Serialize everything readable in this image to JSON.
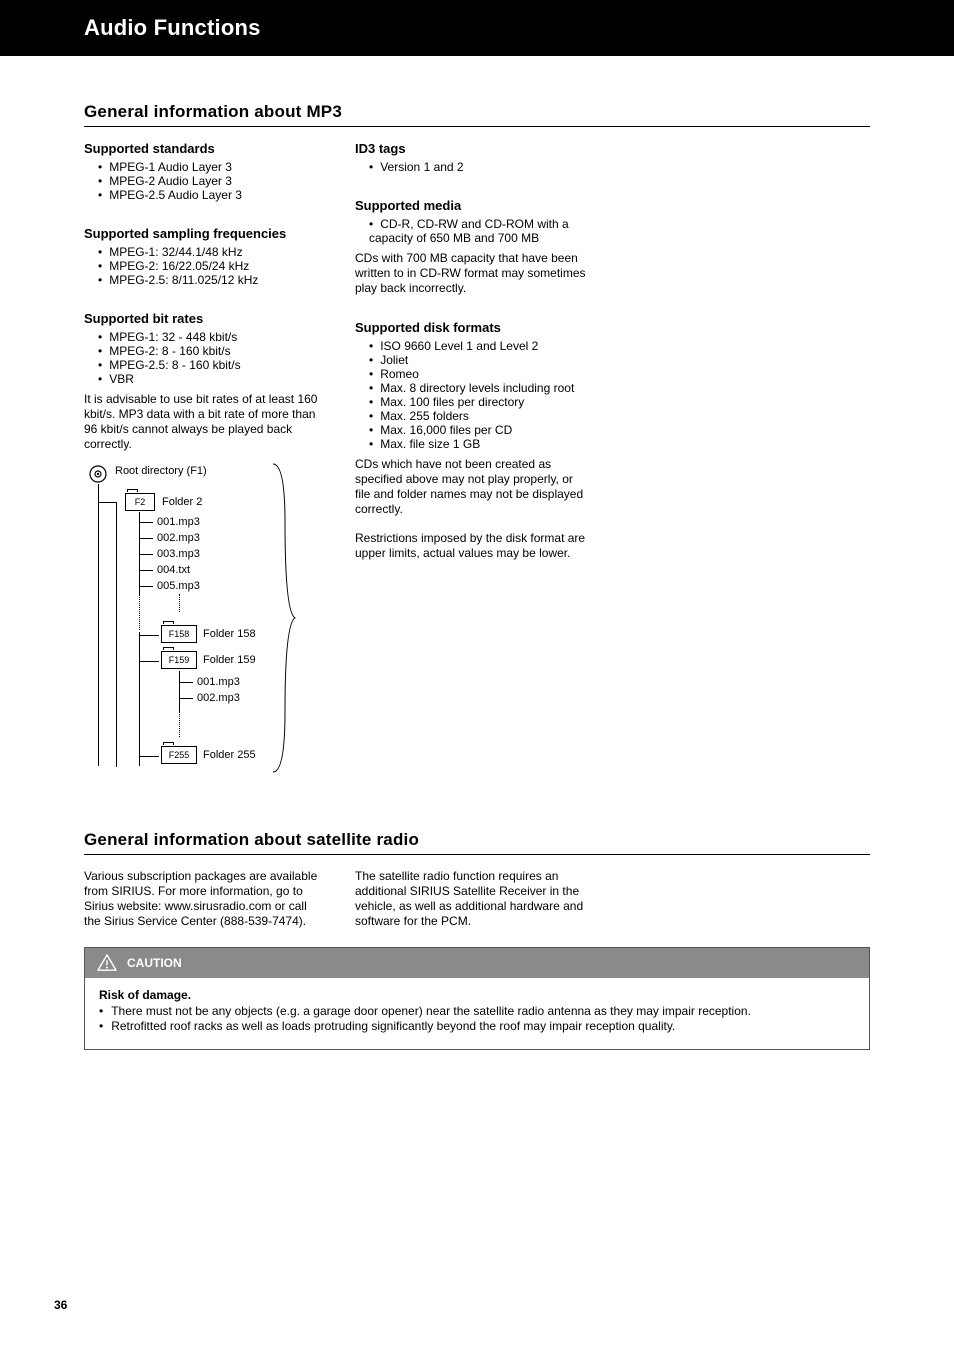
{
  "header": {
    "title": "Audio Functions"
  },
  "section1": {
    "heading": "General information about MP3",
    "supported": {
      "title": "Supported standards",
      "items": [
        "MPEG-1 Audio Layer 3",
        "MPEG-2 Audio Layer 3",
        "MPEG-2.5 Audio Layer 3"
      ]
    },
    "sampling": {
      "title": "Supported sampling frequencies",
      "items": [
        "MPEG-1: 32/44.1/48 kHz",
        "MPEG-2: 16/22.05/24 kHz",
        "MPEG-2.5: 8/11.025/12 kHz"
      ]
    },
    "bitrates": {
      "title": "Supported bit rates",
      "items": [
        "MPEG-1: 32 - 448 kbit/s",
        "MPEG-2: 8 - 160 kbit/s",
        "MPEG-2.5: 8 - 160 kbit/s",
        "VBR"
      ],
      "note": "It is advisable to use bit rates of at least 160 kbit/s. MP3 data with a bit rate of more than 96 kbit/s cannot always be played back correctly."
    },
    "id3": {
      "title": "ID3 tags",
      "items": [
        "Version 1 and 2"
      ]
    },
    "media": {
      "title": "Supported media",
      "items": [
        "CD-R, CD-RW and CD-ROM with a capacity of 650 MB and 700 MB"
      ],
      "note": "CDs with 700 MB capacity that have been written to in CD-RW format may sometimes play back incorrectly."
    },
    "formats": {
      "title": "Supported disk formats",
      "items": [
        "ISO 9660 Level 1 and Level 2",
        "Joliet",
        "Romeo",
        "Max. 8 directory levels including root",
        "Max. 100 files per directory",
        "Max. 255 folders",
        "Max. 16,000 files per CD",
        "Max. file size 1 GB"
      ],
      "note1": "CDs which have not been created as specified above may not play properly, or file and folder names may not be displayed correctly.",
      "note2": "Restrictions imposed by the disk format are upper limits, actual values may be lower."
    }
  },
  "diagram": {
    "root": "Root directory (F1)",
    "f2": "F2",
    "f2_lbl": "Folder 2",
    "files": [
      "001.mp3",
      "002.mp3",
      "003.mp3",
      "004.txt",
      "005.mp3"
    ],
    "f158": "F158",
    "f158_lbl": "Folder 158",
    "f159": "F159",
    "f159_lbl": "Folder 159",
    "f159_files": [
      "001.mp3",
      "002.mp3"
    ],
    "f255": "F255",
    "f255_lbl": "Folder 255"
  },
  "section2": {
    "heading": "General information about satellite radio",
    "p1": "Various subscription packages are available from SIRIUS. For more information, go to Sirius website: www.sirusradio.com or call the Sirius Service Center (888-539-7474).",
    "p2": "The satellite radio function requires an additional SIRIUS Satellite Receiver in the vehicle, as well as additional hardware and software for the PCM.",
    "caution_title": "CAUTION",
    "caution_label": "Risk of damage.",
    "caution_items": [
      "There must not be any objects (e.g. a garage door opener) near the satellite radio antenna as they may impair reception.",
      "Retrofitted roof racks as well as loads protruding significantly beyond the roof may impair reception quality."
    ]
  },
  "page_number": "36"
}
